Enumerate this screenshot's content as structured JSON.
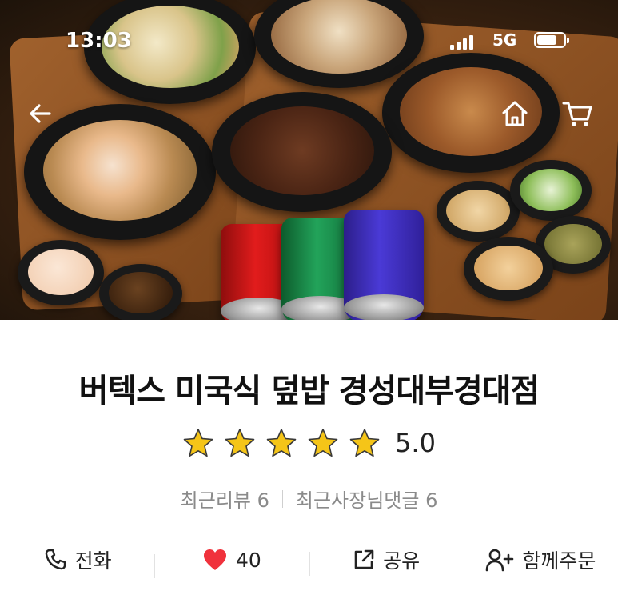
{
  "status_bar": {
    "time": "13:03",
    "network": "5G"
  },
  "store": {
    "name": "버텍스 미국식 덮밥 경성대부경대점",
    "rating": 5.0,
    "rating_text": "5.0",
    "stars_filled": 5,
    "recent_reviews": "최근리뷰 6",
    "recent_owner_comments": "최근사장님댓글 6"
  },
  "actions": {
    "call": "전화",
    "like_count": "40",
    "share": "공유",
    "group_order": "함께주문"
  },
  "colors": {
    "star": "#f5c518",
    "heart": "#f0323c"
  }
}
